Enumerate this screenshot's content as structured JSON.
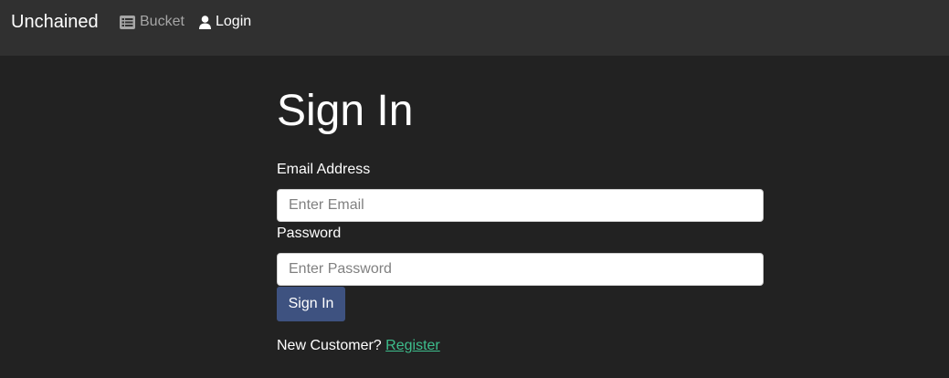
{
  "navbar": {
    "brand": "Unchained",
    "links": [
      {
        "label": "Bucket",
        "icon": "list-icon"
      },
      {
        "label": "Login",
        "icon": "user-icon"
      }
    ]
  },
  "form": {
    "title": "Sign In",
    "email_label": "Email Address",
    "email_placeholder": "Enter Email",
    "email_value": "",
    "password_label": "Password",
    "password_placeholder": "Enter Password",
    "password_value": "",
    "submit_label": "Sign In",
    "register_prompt": "New Customer?",
    "register_link": "Register"
  },
  "colors": {
    "page_background": "#222222",
    "navbar_background": "#303030",
    "button_primary": "#3e5280",
    "link_accent": "#3dbd8c",
    "muted_nav_link": "#a6a6a6"
  }
}
